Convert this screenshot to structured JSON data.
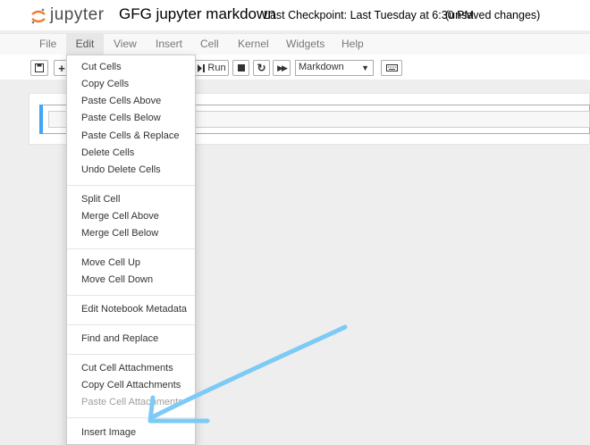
{
  "header": {
    "logo_text": "jupyter",
    "notebook_title": "GFG jupyter markdown",
    "checkpoint": "Last Checkpoint: Last Tuesday at 6:30 PM",
    "autosave": "(unsaved changes)"
  },
  "menubar": {
    "items": [
      "File",
      "Edit",
      "View",
      "Insert",
      "Cell",
      "Kernel",
      "Widgets",
      "Help"
    ]
  },
  "toolbar": {
    "run_label": "Run",
    "cell_type": "Markdown"
  },
  "edit_menu": {
    "groups": [
      [
        "Cut Cells",
        "Copy Cells",
        "Paste Cells Above",
        "Paste Cells Below",
        "Paste Cells & Replace",
        "Delete Cells",
        "Undo Delete Cells"
      ],
      [
        "Split Cell",
        "Merge Cell Above",
        "Merge Cell Below"
      ],
      [
        "Move Cell Up",
        "Move Cell Down"
      ],
      [
        "Edit Notebook Metadata"
      ],
      [
        "Find and Replace"
      ],
      [
        "Cut Cell Attachments",
        "Copy Cell Attachments",
        "Paste Cell Attachments"
      ],
      [
        "Insert Image"
      ]
    ]
  },
  "colors": {
    "logo_orange": "#f37726",
    "cell_selected": "#42a5f5",
    "annotation_arrow": "#7ccaf6"
  },
  "icons": [
    "save-icon",
    "plus-icon",
    "step-forward-icon",
    "stop-icon",
    "redo-icon",
    "fast-forward-icon",
    "keyboard-icon"
  ]
}
